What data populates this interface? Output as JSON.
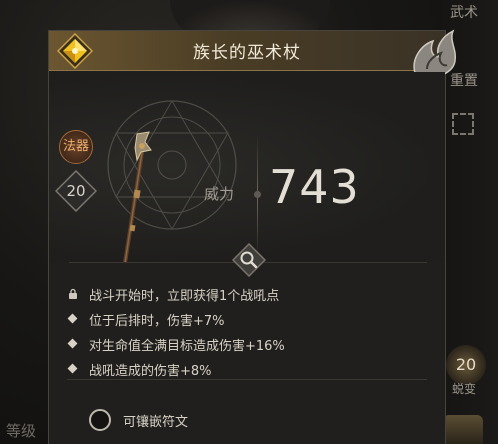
{
  "background": {
    "side_text_top": "武术",
    "side_text_mid": "重置",
    "side_orb_value": "20",
    "side_orb_text": "蜕变",
    "level_label": "等级"
  },
  "item": {
    "name": "族长的巫术杖",
    "type_badge": "法器",
    "level": "20",
    "power_label": "威力",
    "power_value": "743",
    "icons": {
      "rarity": "yellow-diamond-gem-icon",
      "emblem": "rune-emblem-icon",
      "weapon": "staff-icon",
      "inspect": "magnifier-icon",
      "lock": "lock-icon"
    }
  },
  "effects": [
    {
      "text": "战斗开始时，立即获得1个战吼点",
      "bullet": "lock-icon"
    },
    {
      "text": "位于后排时，伤害+7%",
      "bullet": "diamond"
    },
    {
      "text": "对生命值全满目标造成伤害+16%",
      "bullet": "diamond"
    },
    {
      "text": "战吼造成的伤害+8%",
      "bullet": "diamond"
    }
  ],
  "rune_slot": {
    "label": "可镶嵌符文"
  },
  "colors": {
    "title_bar": "#6b5630",
    "gem": "#f0c020",
    "type_badge": "#f0b070",
    "panel_bg": "#201f1d"
  }
}
